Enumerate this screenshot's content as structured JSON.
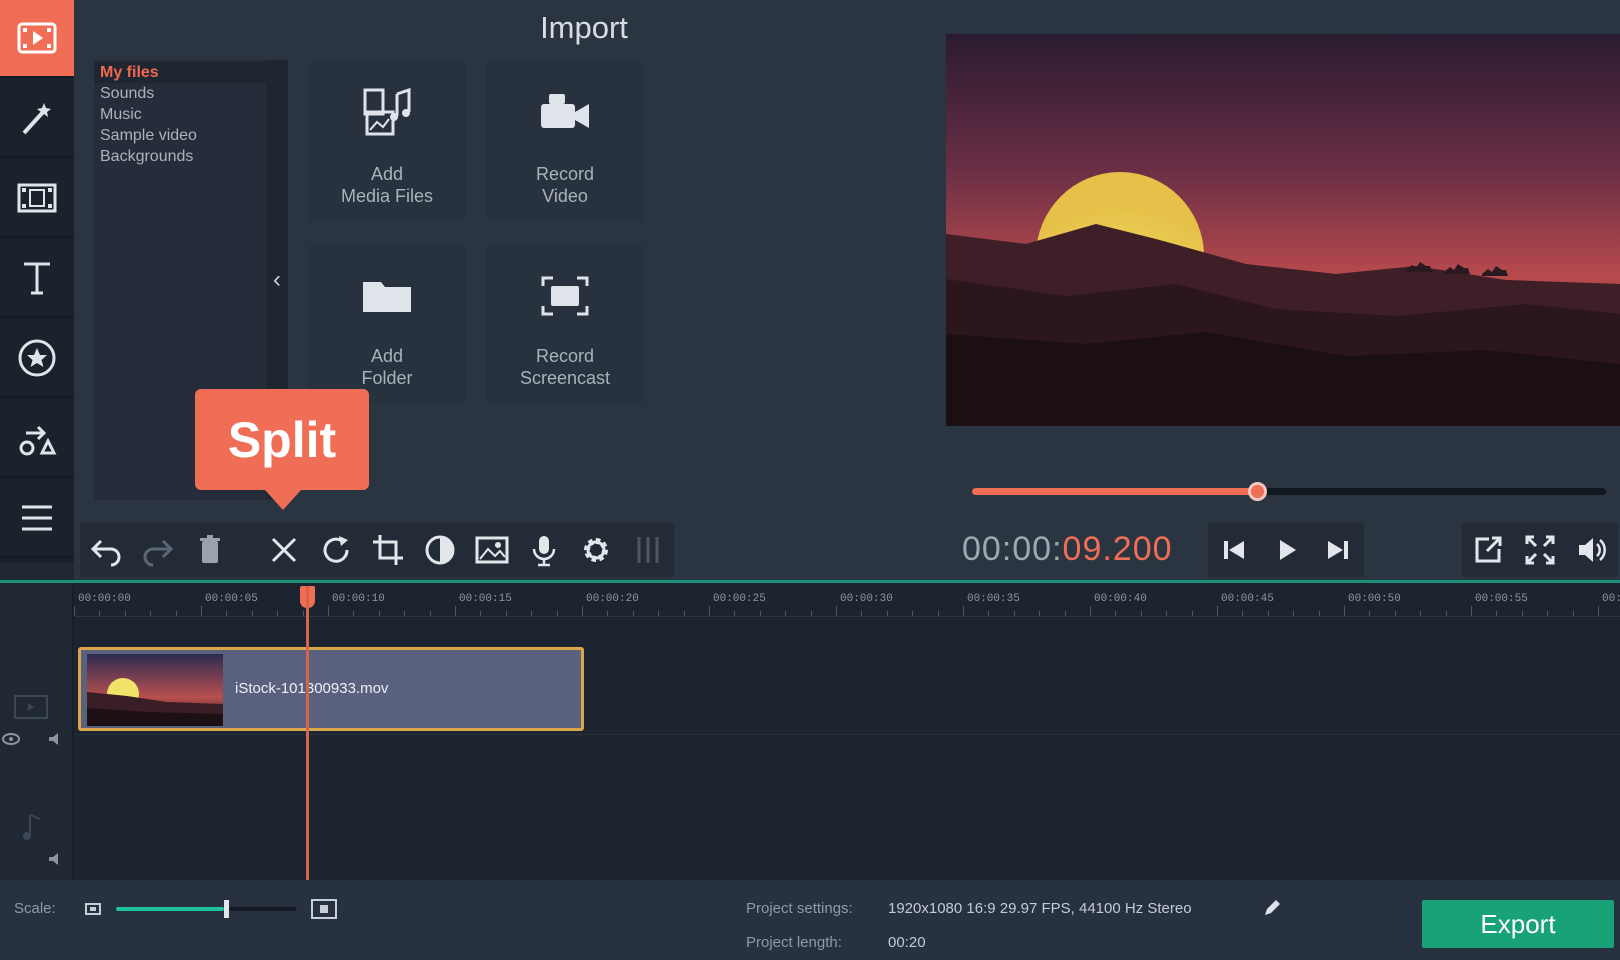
{
  "app": {
    "accent_color": "#f06e55",
    "export_color": "#17a278"
  },
  "rail": {
    "items": [
      {
        "icon": "import-media-icon",
        "active": true
      },
      {
        "icon": "magic-wand-icon",
        "active": false
      },
      {
        "icon": "film-transitions-icon",
        "active": false
      },
      {
        "icon": "titles-text-icon",
        "active": false
      },
      {
        "icon": "stickers-star-icon",
        "active": false
      },
      {
        "icon": "shapes-callouts-icon",
        "active": false
      },
      {
        "icon": "more-menu-icon",
        "active": false
      }
    ]
  },
  "import_panel": {
    "title": "Import",
    "folders": [
      "My files",
      "Sounds",
      "Music",
      "Sample video",
      "Backgrounds"
    ],
    "selected_folder": "My files",
    "tiles": [
      {
        "label_line1": "Add",
        "label_line2": "Media Files",
        "icon": "media-files-icon"
      },
      {
        "label_line1": "Record",
        "label_line2": "Video",
        "icon": "video-camera-icon"
      },
      {
        "label_line1": "Add",
        "label_line2": "Folder",
        "icon": "folder-icon"
      },
      {
        "label_line1": "Record",
        "label_line2": "Screencast",
        "icon": "screencast-icon"
      }
    ]
  },
  "callout": {
    "text": "Split"
  },
  "player": {
    "timecode_main": "00:00:",
    "timecode_frac": "09.200",
    "progress": 0.45
  },
  "toolbar": {
    "tools": [
      "undo-icon",
      "redo-icon",
      "delete-icon",
      "split-scissors-icon",
      "rotate-icon",
      "crop-icon",
      "color-adjust-icon",
      "insert-image-icon",
      "record-audio-icon",
      "settings-gear-icon",
      "equalizer-icon"
    ]
  },
  "timeline": {
    "ticks": [
      "00:00:00",
      "00:00:05",
      "00:00:10",
      "00:00:15",
      "00:00:20",
      "00:00:25",
      "00:00:30",
      "00:00:35",
      "00:00:40",
      "00:00:45",
      "00:00:50",
      "00:00:55",
      "00:0"
    ],
    "clip_name": "iStock-101300933.mov"
  },
  "status": {
    "scale_label": "Scale:",
    "scale_value": 0.6,
    "project_settings_label": "Project settings:",
    "project_settings_value": "1920x1080 16:9 29.97 FPS, 44100 Hz Stereo",
    "project_length_label": "Project length:",
    "project_length_value": "00:20",
    "export_label": "Export"
  }
}
